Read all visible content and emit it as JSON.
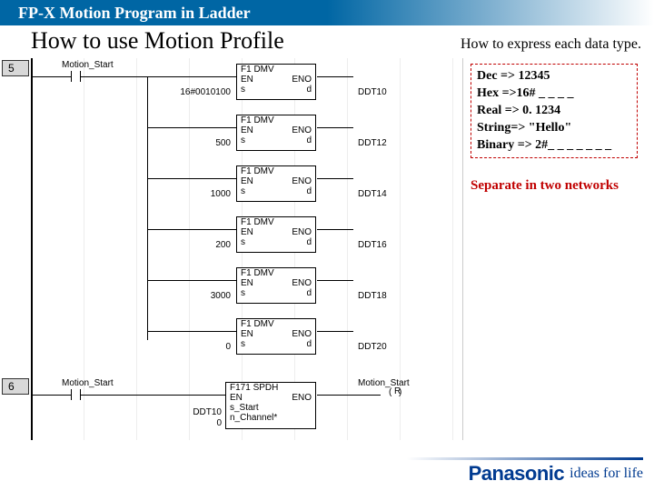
{
  "header": "FP-X Motion Program in Ladder",
  "title": "How to use Motion Profile",
  "subtitle": "How to express each data type.",
  "legend": {
    "l1": "Dec => 12345",
    "l2": "Hex =>16# _ _ _ _",
    "l3": "Real => 0. 1234",
    "l4": "String=> \"Hello\"",
    "l5": "Binary => 2#_ _ _ _ _ _ _"
  },
  "separator_note": "Separate in two networks",
  "rungs": {
    "r5": "5",
    "r6": "6"
  },
  "contact": {
    "motion_start": "Motion_Start"
  },
  "fblocks": [
    {
      "in": "16#0010100",
      "out": "DDT10"
    },
    {
      "in": "500",
      "out": "DDT12"
    },
    {
      "in": "1000",
      "out": "DDT14"
    },
    {
      "in": "200",
      "out": "DDT16"
    },
    {
      "in": "3000",
      "out": "DDT18"
    },
    {
      "in": "0",
      "out": "DDT20"
    }
  ],
  "dmv": {
    "name": "F1 DMV",
    "en": "EN",
    "eno": "ENO",
    "s": "s",
    "d": "d"
  },
  "spdh": {
    "name": "F171 SPDH",
    "en": "EN",
    "eno": "ENO",
    "in1_lbl": "s_Start",
    "in1_val": "DDT10",
    "in2_lbl": "n_Channel*",
    "in2_val": "0",
    "out_contact": "Motion_Start",
    "out_coil": "R"
  },
  "footer": {
    "brand": "Panasonic",
    "tag": "ideas for life"
  }
}
